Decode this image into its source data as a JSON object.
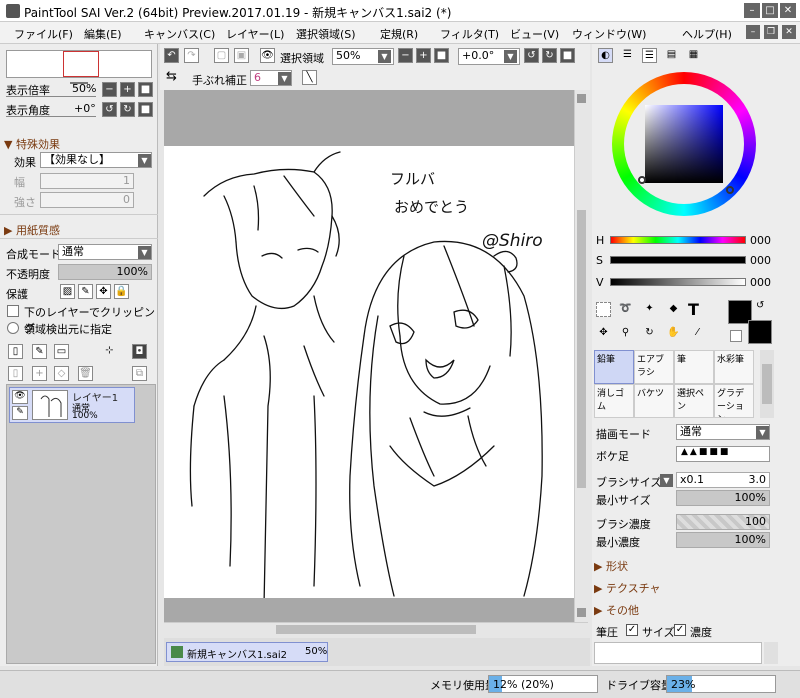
{
  "titlebar": {
    "title": "PaintTool SAI Ver.2 (64bit) Preview.2017.01.19 - 新規キャンバス1.sai2 (*)",
    "min": "–",
    "max": "□",
    "close": "✕"
  },
  "menu": {
    "items": [
      "ファイル(F)",
      "編集(E)",
      "キャンバス(C)",
      "レイヤー(L)",
      "選択領域(S)",
      "定規(R)",
      "フィルタ(T)",
      "ビュー(V)",
      "ウィンドウ(W)",
      "ヘルプ(H)"
    ]
  },
  "left": {
    "zoom_label": "表示倍率",
    "zoom_value": "50%",
    "angle_label": "表示角度",
    "angle_value": "+0°",
    "effects_header": "▼ 特殊効果",
    "effect_label": "効果",
    "effect_value": "【効果なし】",
    "width_label": "幅",
    "width_value": "1",
    "strength_label": "強さ",
    "strength_value": "0",
    "paper_header": "▶ 用紙質感",
    "blend_label": "合成モード",
    "blend_value": "通常",
    "opacity_label": "不透明度",
    "opacity_value": "100%",
    "protect_label": "保護",
    "clip_label": "下のレイヤーでクリッピング",
    "detect_label": "領域検出元に指定",
    "layer": {
      "name": "レイヤー1",
      "mode": "通常",
      "opacity": "100%"
    }
  },
  "toolbar": {
    "selection_label": "選択領域",
    "zoom_value": "50%",
    "angle_value": "+0.0°",
    "stabilizer_label": "手ぶれ補正",
    "stabilizer_value": "6"
  },
  "canvas": {
    "text1": "フルバ",
    "text2": "おめでとう",
    "text3": "@Shiro"
  },
  "doctab": {
    "name": "新規キャンバス1.sai2",
    "zoom": "50%"
  },
  "right": {
    "h_label": "H",
    "h_value": "000",
    "s_label": "S",
    "s_value": "000",
    "v_label": "V",
    "v_value": "000",
    "tools": [
      {
        "label": "鉛筆",
        "selected": true
      },
      {
        "label": "エアブラシ",
        "selected": false
      },
      {
        "label": "筆",
        "selected": false
      },
      {
        "label": "水彩筆",
        "selected": false
      },
      {
        "label": "消しゴム",
        "selected": false
      },
      {
        "label": "バケツ",
        "selected": false
      },
      {
        "label": "選択ペン",
        "selected": false
      },
      {
        "label": "グラデーション",
        "selected": false
      }
    ],
    "draw_mode_label": "描画モード",
    "draw_mode_value": "通常",
    "blur_label": "ボケ足",
    "brush_size_label": "ブラシサイズ",
    "brush_size_mult": "x0.1",
    "brush_size_value": "3.0",
    "min_size_label": "最小サイズ",
    "min_size_value": "100%",
    "brush_density_label": "ブラシ濃度",
    "brush_density_value": "100",
    "min_density_label": "最小濃度",
    "min_density_value": "100%",
    "shape_header": "▶ 形状",
    "texture_header": "▶ テクスチャ",
    "other_header": "▶ その他",
    "pressure_label": "筆圧",
    "pressure_size": "サイズ",
    "pressure_density": "濃度"
  },
  "status": {
    "memory_label": "メモリ使用量",
    "memory_value": "12% (20%)",
    "memory_fraction": 0.12,
    "drive_label": "ドライブ容量",
    "drive_value": "23%",
    "drive_fraction": 0.23
  },
  "colors": {
    "accent": "#8090d0",
    "paper": "#ffffff",
    "canvas_bg": "#a8a8a8",
    "primary": "#000000",
    "secondary": "#000000"
  }
}
